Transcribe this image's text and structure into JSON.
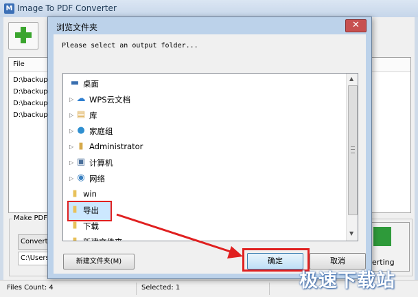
{
  "main_window": {
    "app_icon": "M",
    "title": "Image To PDF Converter",
    "file_column_header": "File",
    "file_rows": [
      "D:\\backup",
      "D:\\backup",
      "D:\\backup",
      "D:\\backup"
    ],
    "make_pdf_label": "Make PDF",
    "convert_button": "Convert",
    "output_path": "C:\\Users",
    "converting_label": "erting"
  },
  "status_bar": {
    "files_count": "Files Count: 4",
    "selected": "Selected: 1"
  },
  "dialog": {
    "title": "浏览文件夹",
    "close_glyph": "✕",
    "prompt": "Please select an output folder...",
    "tree_items": [
      {
        "label": "桌面",
        "icon": "desktop-icon",
        "glyph": "▬",
        "color": "#3a6fb0",
        "has_expander": false
      },
      {
        "label": "WPS云文档",
        "icon": "cloud-icon",
        "glyph": "☁",
        "color": "#2f7fd0",
        "has_expander": true
      },
      {
        "label": "库",
        "icon": "library-icon",
        "glyph": "▤",
        "color": "#d9a440",
        "has_expander": true
      },
      {
        "label": "家庭组",
        "icon": "homegroup-icon",
        "glyph": "●",
        "color": "#2f8fd0",
        "has_expander": true
      },
      {
        "label": "Administrator",
        "icon": "user-folder-icon",
        "glyph": "▮",
        "color": "#d6a94a",
        "has_expander": true
      },
      {
        "label": "计算机",
        "icon": "computer-icon",
        "glyph": "▣",
        "color": "#4a6f9a",
        "has_expander": true
      },
      {
        "label": "网络",
        "icon": "network-icon",
        "glyph": "◉",
        "color": "#3a80c0",
        "has_expander": true
      },
      {
        "label": "win",
        "icon": "folder-icon",
        "glyph": "▮",
        "color": "#e8c15a",
        "has_expander": false
      },
      {
        "label": "导出",
        "icon": "folder-icon",
        "glyph": "▮",
        "color": "#e8c15a",
        "has_expander": false
      },
      {
        "label": "下载",
        "icon": "folder-icon",
        "glyph": "▮",
        "color": "#e8c15a",
        "has_expander": false
      },
      {
        "label": "新建文件夹",
        "icon": "folder-icon",
        "glyph": "▮",
        "color": "#e8c15a",
        "has_expander": false
      }
    ],
    "selected_item": "导出",
    "new_folder_button": "新建文件夹(M)",
    "ok_button": "确定",
    "cancel_button": "取消"
  },
  "watermark": "极速下载站",
  "colors": {
    "annotation_red": "#e02020",
    "dialog_frame": "#bcd2ea",
    "close_red": "#c75050",
    "selection_fill": "#cce8ff"
  }
}
